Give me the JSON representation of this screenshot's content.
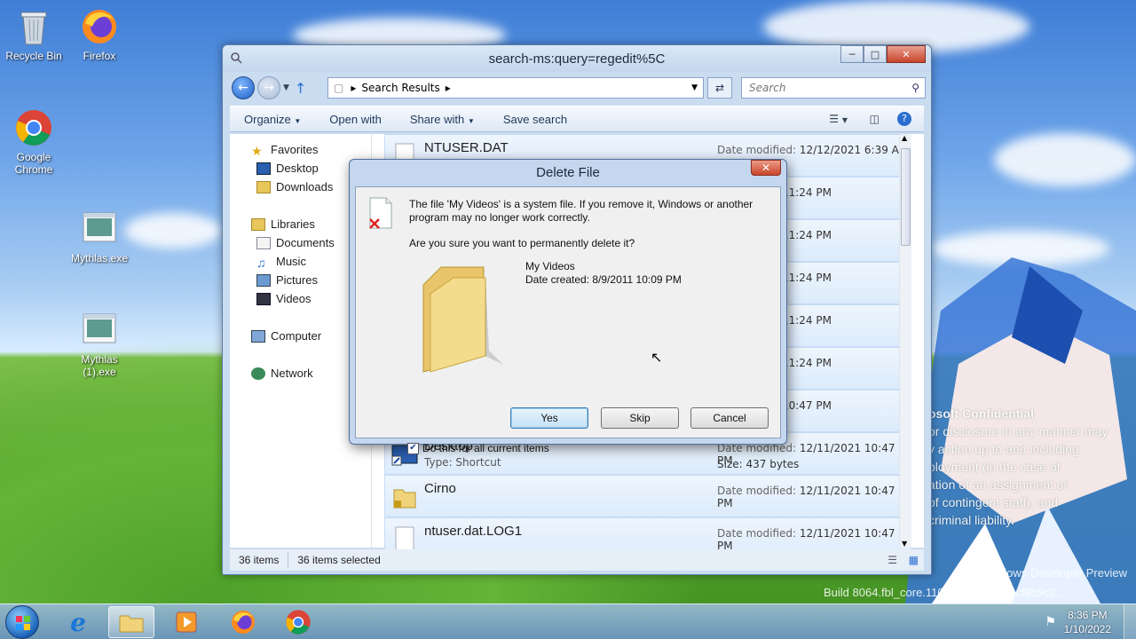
{
  "desktop": {
    "icons": [
      {
        "label": "Recycle Bin"
      },
      {
        "label": "Firefox"
      },
      {
        "label": "Google Chrome"
      },
      {
        "label": "Mythlas.exe"
      },
      {
        "label": "Mythlas (1).exe"
      }
    ],
    "watermark": {
      "lines": [
        "osoft Confidential",
        "or disclosure in any manner may",
        "y action up to and including",
        "ployment (in the case of",
        "ation of an assignment or",
        "of contingent staff), and",
        "criminal liability."
      ]
    },
    "build": {
      "line1": "Windows Developer Preview",
      "line2": "Build 8064.fbl_core.110806-1000.959cf9b9c3..."
    }
  },
  "explorer": {
    "title": "search-ms:query=regedit%5C",
    "address": {
      "breadcrumb": "Search Results"
    },
    "search": {
      "placeholder": "Search"
    },
    "toolbar": {
      "organize": "Organize",
      "open_with": "Open with",
      "share_with": "Share with",
      "save_search": "Save search"
    },
    "nav": {
      "favorites": "Favorites",
      "desktop": "Desktop",
      "downloads": "Downloads",
      "libraries": "Libraries",
      "documents": "Documents",
      "music": "Music",
      "pictures": "Pictures",
      "videos": "Videos",
      "computer": "Computer",
      "network": "Network"
    },
    "files": [
      {
        "name": "NTUSER.DAT",
        "date_label": "Date modified:",
        "date": "12/12/2021 6:39 AM",
        "type": "",
        "size": ""
      },
      {
        "name": "",
        "date_label": "",
        "date": "12/11/2021 11:24 PM",
        "type": "",
        "size": ""
      },
      {
        "name": "",
        "date_label": "",
        "date": "12/11/2021 11:24 PM",
        "type": "",
        "size": ""
      },
      {
        "name": "",
        "date_label": "",
        "date": "12/11/2021 11:24 PM",
        "type": "",
        "size": ""
      },
      {
        "name": "",
        "date_label": "",
        "date": "12/11/2021 11:24 PM",
        "type": "",
        "size": ""
      },
      {
        "name": "",
        "date_label": "",
        "date": "12/11/2021 11:24 PM",
        "type": "",
        "size": ""
      },
      {
        "name": "",
        "date_label": "",
        "date": "12/11/2021 10:47 PM",
        "type": "",
        "size": ""
      },
      {
        "name": "Desktop",
        "date_label": "Date modified:",
        "date": "12/11/2021 10:47 PM",
        "type": "Type: Shortcut",
        "size": "Size: 437 bytes"
      },
      {
        "name": "Cirno",
        "date_label": "Date modified:",
        "date": "12/11/2021 10:47 PM",
        "type": "",
        "size": ""
      },
      {
        "name": "ntuser.dat.LOG1",
        "date_label": "Date modified:",
        "date": "12/11/2021 10:47 PM",
        "type": "",
        "size": ""
      }
    ],
    "status": {
      "items": "36 items",
      "selected": "36 items selected"
    }
  },
  "dialog": {
    "title": "Delete File",
    "message": "The file 'My Videos' is a system file. If you remove it, Windows or another program may no longer work correctly.",
    "question": "Are you sure you want to permanently delete it?",
    "file_name": "My Videos",
    "file_date": "Date created: 8/9/2011 10:09 PM",
    "yes": "Yes",
    "skip": "Skip",
    "cancel": "Cancel",
    "checkbox_label": "Do this for all current items",
    "checkbox_checked": true
  },
  "taskbar": {
    "time": "8:36 PM",
    "date": "1/10/2022"
  },
  "colors": {
    "accent": "#1d5fc4",
    "dialog_frame": "#c4d7ee",
    "close_red": "#c8442b"
  }
}
